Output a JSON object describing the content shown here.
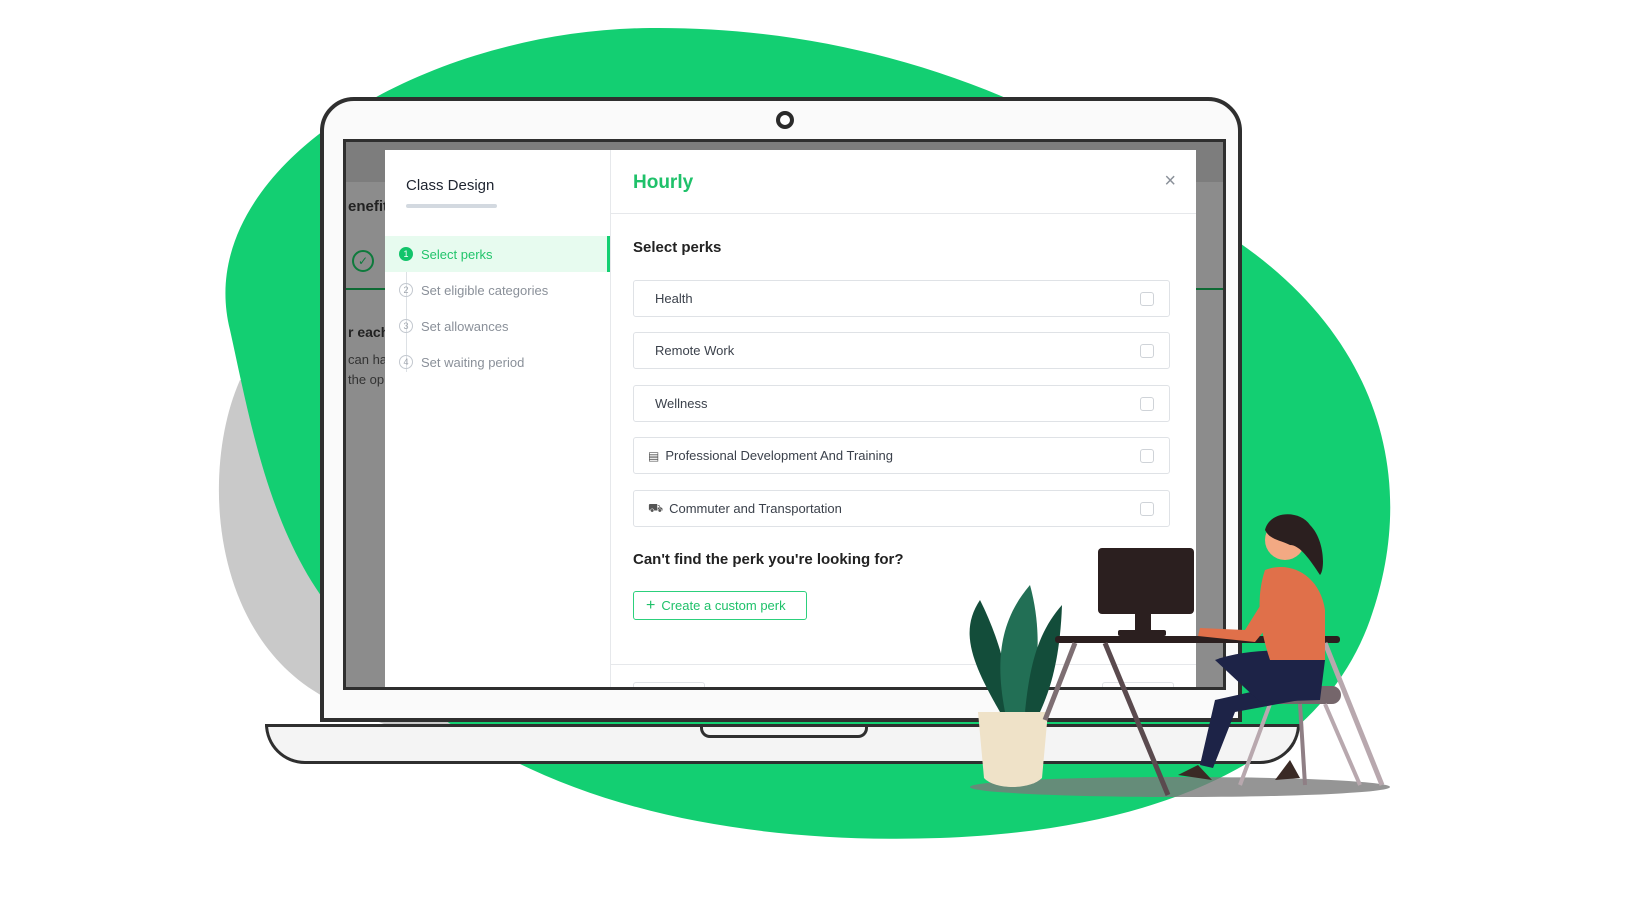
{
  "colors": {
    "accent": "#13cf72",
    "blob_green": "#13cf72",
    "blob_gray": "#c9c9c9",
    "title_green": "#1fc16a"
  },
  "background_app": {
    "text_1": "enefit",
    "text_2": "r each",
    "text_3": "can ha",
    "text_4": "the op",
    "check_icon": "check-circle-icon"
  },
  "sidebar": {
    "title": "Class Design",
    "steps": [
      {
        "num": "1",
        "label": "Select perks",
        "active": true
      },
      {
        "num": "2",
        "label": "Set eligible categories",
        "active": false
      },
      {
        "num": "3",
        "label": "Set allowances",
        "active": false
      },
      {
        "num": "4",
        "label": "Set waiting period",
        "active": false
      }
    ]
  },
  "main": {
    "title": "Hourly",
    "close_icon": "×",
    "subtitle": "Select perks",
    "perks": [
      {
        "label": "Health",
        "icon": ""
      },
      {
        "label": "Remote Work",
        "icon": ""
      },
      {
        "label": "Wellness",
        "icon": ""
      },
      {
        "label": "Professional Development And Training",
        "icon": "book-icon",
        "glyph": "▤"
      },
      {
        "label": "Commuter and Transportation",
        "icon": "train-icon",
        "glyph": "⛟"
      }
    ],
    "question": "Can't find the perk you're looking for?",
    "custom_button": {
      "plus": "+",
      "label": "Create a custom perk"
    }
  }
}
